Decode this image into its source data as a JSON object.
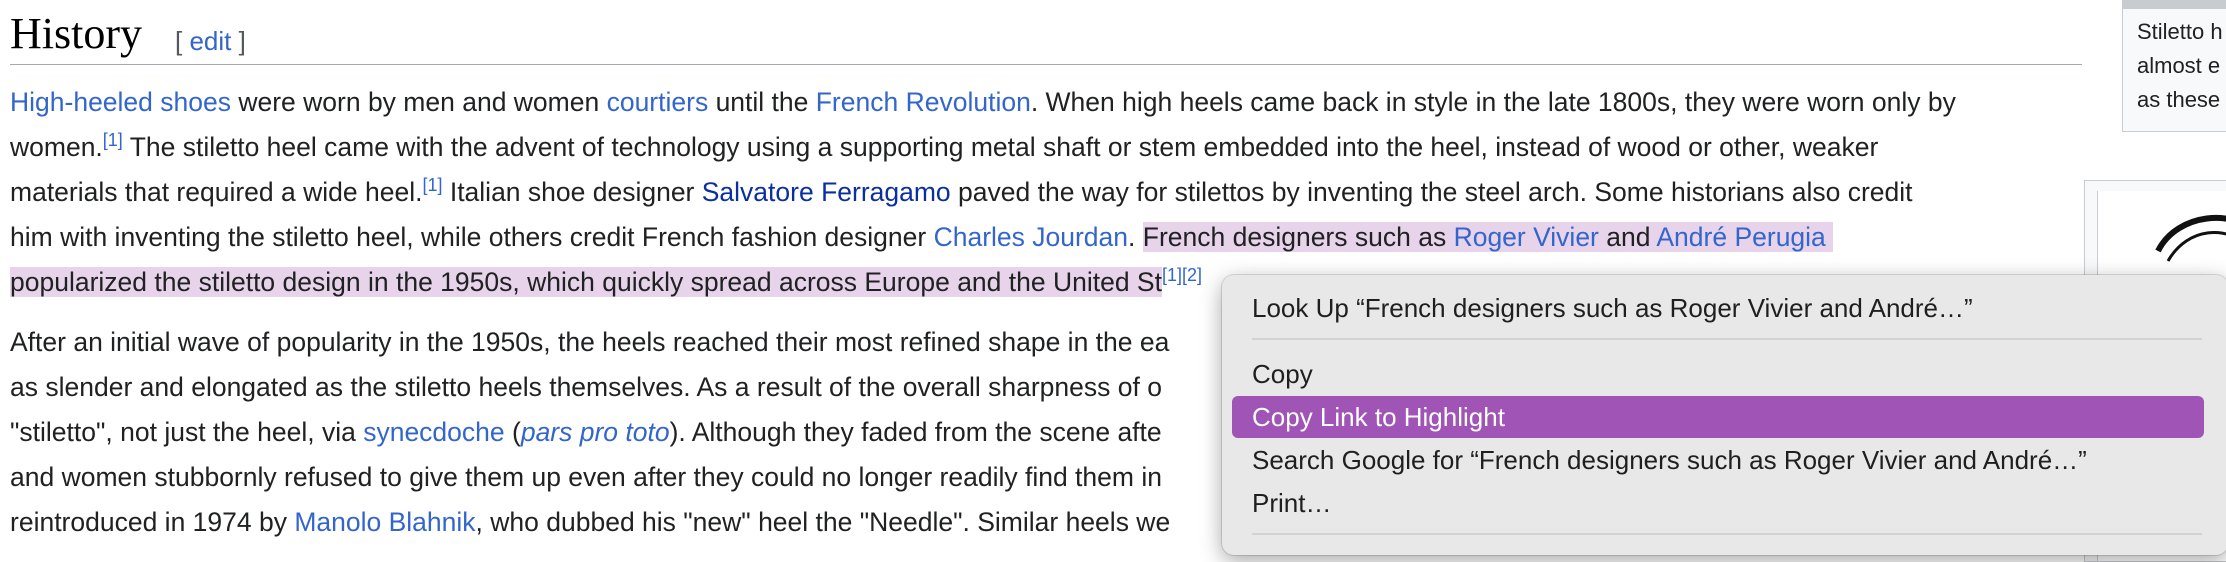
{
  "heading": {
    "title": "History",
    "edit_open": "[ ",
    "edit_label": "edit",
    "edit_close": " ]"
  },
  "para1": {
    "l1_a": "High-heeled shoes",
    "l1_b": " were worn by men and women ",
    "l1_c": "courtiers",
    "l1_d": " until the ",
    "l1_e": "French Revolution",
    "l1_f": ". When high heels came back in style in the late 1800s, they were worn only by",
    "l2_a": "women.",
    "l2_ref": "[1]",
    "l2_b": " The stiletto heel came with the advent of technology using a supporting metal shaft or stem embedded into the heel, instead of wood or other, weaker",
    "l3_a": "materials that required a wide heel.",
    "l3_ref": "[1]",
    "l3_b": " Italian shoe designer ",
    "l3_c": "Salvatore Ferragamo",
    "l3_d": " paved the way for stilettos by inventing the steel arch. Some historians also credit",
    "l4_a": "him with inventing the stiletto heel, while others credit French fashion designer ",
    "l4_b": "Charles Jourdan",
    "l4_c": ". ",
    "l4_hl_a": "French designers such as ",
    "l4_hl_b": "Roger Vivier",
    "l4_hl_c": " and ",
    "l4_hl_d": "André Perugia",
    "l5_hl": "popularized the stiletto design in the 1950s, which quickly spread across Europe and the United St",
    "l5_ref": "[1][2]"
  },
  "para2": {
    "l1": "After an initial wave of popularity in the 1950s, the heels reached their most refined shape in the ea",
    "l2": "as slender and elongated as the stiletto heels themselves. As a result of the overall sharpness of o",
    "l3_a": "\"stiletto\", not just the heel, via ",
    "l3_b": "synecdoche",
    "l3_c": " (",
    "l3_d": "pars pro toto",
    "l3_e": "). Although they faded from the scene afte",
    "l4": "and women stubbornly refused to give them up even after they could no longer readily find them in",
    "l5_a": "reintroduced in 1974 by ",
    "l5_b": "Manolo Blahnik",
    "l5_c": ", who dubbed his \"new\" heel the \"Needle\". Similar heels we"
  },
  "thumb1": {
    "caption_lines": [
      "Stiletto h",
      "almost e",
      "as these"
    ]
  },
  "context_menu": {
    "look_up": "Look Up “French designers such as Roger Vivier and André…”",
    "copy": "Copy",
    "copy_link": "Copy Link to Highlight",
    "search_google": "Search Google for “French designers such as Roger Vivier and André…”",
    "print": "Print…",
    "selected_color": "#9f54b6",
    "highlight_color": "#e7d3ea"
  }
}
